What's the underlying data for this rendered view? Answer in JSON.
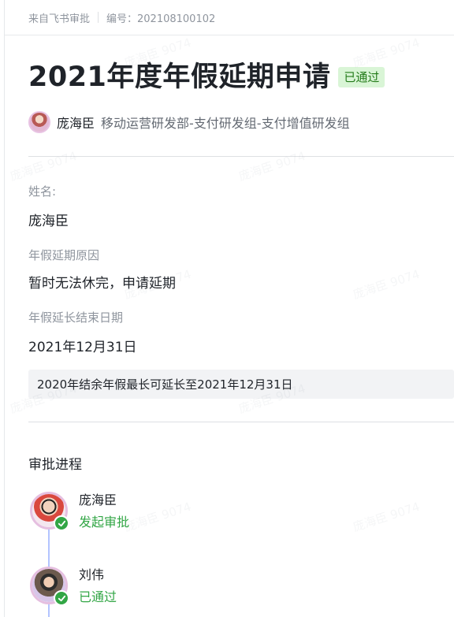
{
  "header": {
    "source": "来自飞书审批",
    "serial": "编号：202108100102"
  },
  "approval": {
    "title": "2021年度年假延期申请",
    "status": "已通过",
    "applicant_name": "庞海臣",
    "applicant_department": "移动运营研发部-支付研发组-支付增值研发组"
  },
  "fields": [
    {
      "label": "姓名:",
      "value": "庞海臣"
    },
    {
      "label": "年假延期原因",
      "value": "暂时无法休完，申请延期"
    },
    {
      "label": "年假延长结束日期",
      "value": "2021年12月31日"
    }
  ],
  "note": "2020年结余年假最长可延长至2021年12月31日",
  "process": {
    "title": "审批进程",
    "steps": [
      {
        "name": "庞海臣",
        "status": "发起审批"
      },
      {
        "name": "刘伟",
        "status": "已通过"
      }
    ]
  },
  "watermark": "庞海臣 9074",
  "colors": {
    "approved_bg": "#d9f5d6",
    "approved_text": "#237b19",
    "success": "#32a645",
    "timeline": "#b3c4ff"
  },
  "icons": {
    "step_done": "check-icon"
  }
}
